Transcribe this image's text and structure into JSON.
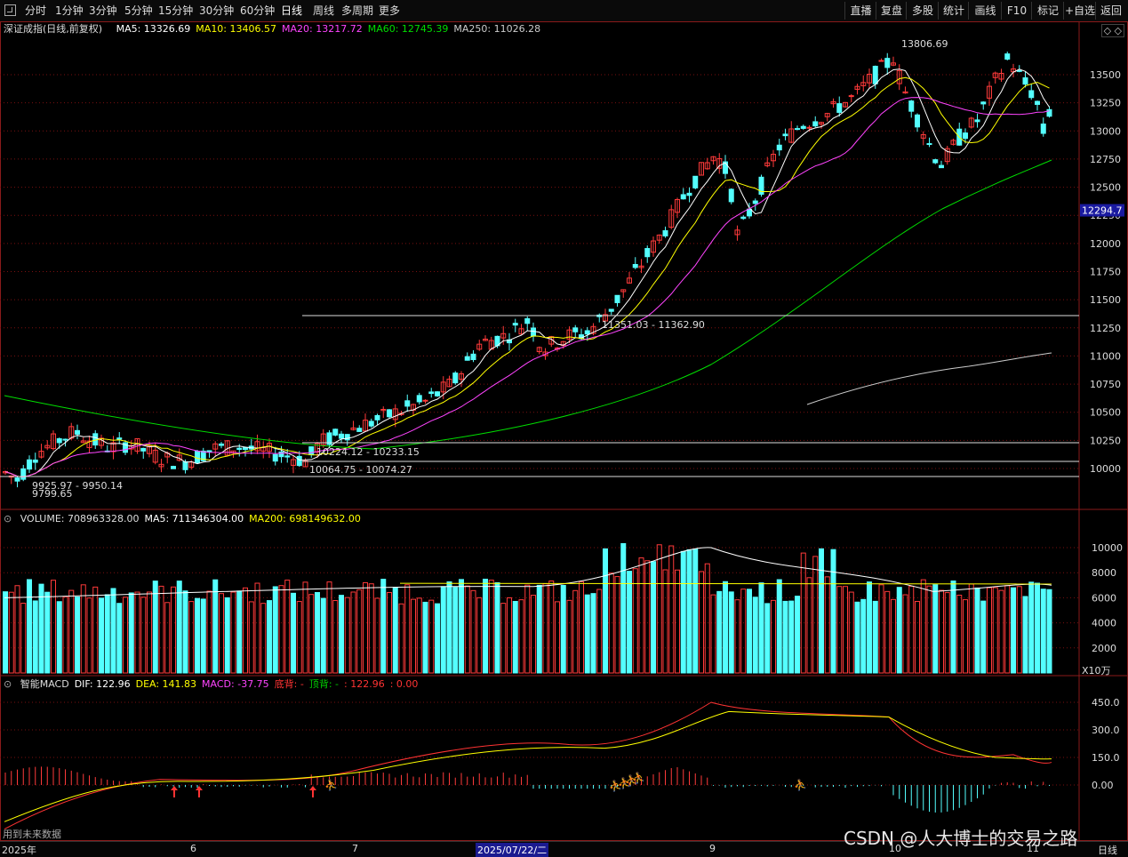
{
  "menu": {
    "left": [
      "分时",
      "1分钟",
      "3分钟",
      "5分钟",
      "15分钟",
      "30分钟",
      "60分钟",
      "日线",
      "周线",
      "多周期",
      "更多"
    ],
    "active": "日线",
    "right": [
      "直播",
      "复盘",
      "多股",
      "统计",
      "画线",
      "F10",
      "标记",
      "+自选",
      "返回"
    ]
  },
  "price_panel": {
    "name": "深证成指(日线,前复权)",
    "ma": [
      {
        "label": "MA5: 13326.69",
        "color": "#ffffff"
      },
      {
        "label": "MA10: 13406.57",
        "color": "#ffff00"
      },
      {
        "label": "MA20: 13217.72",
        "color": "#ff44ff"
      },
      {
        "label": "MA60: 12745.39",
        "color": "#00dd00"
      },
      {
        "label": "MA250: 11026.28",
        "color": "#cccccc"
      }
    ],
    "current_price": "12294.7",
    "y_ticks": [
      "13500",
      "13250",
      "13000",
      "12750",
      "12500",
      "12250",
      "12000",
      "11750",
      "11500",
      "11250",
      "11000",
      "10750",
      "10500",
      "10250",
      "10000"
    ],
    "annotations": {
      "high": "13806.69",
      "low": "9799.65",
      "range1": "9925.97 - 9950.14",
      "range2": "10224.12 - 10233.15",
      "range3": "10064.75 - 10074.27",
      "range4": "11351.03 - 11362.90"
    }
  },
  "volume_panel": {
    "info": [
      {
        "label": "VOLUME: 708963328.00",
        "color": "#dddddd"
      },
      {
        "label": "MA5: 711346304.00",
        "color": "#ffffff"
      },
      {
        "label": "MA200: 698149632.00",
        "color": "#ffff00"
      }
    ],
    "y_ticks": [
      "10000",
      "8000",
      "6000",
      "4000",
      "2000"
    ],
    "unit": "X10万"
  },
  "macd_panel": {
    "info": [
      {
        "label": "智能MACD",
        "color": "#dddddd"
      },
      {
        "label": "DIF: 122.96",
        "color": "#ffffff"
      },
      {
        "label": "DEA: 141.83",
        "color": "#ffff00"
      },
      {
        "label": "MACD: -37.75",
        "color": "#ff44ff"
      },
      {
        "label": "底背: -",
        "color": "#ff3333"
      },
      {
        "label": "顶背: -",
        "color": "#00cc00"
      },
      {
        "label": ": 122.96",
        "color": "#ff3333"
      },
      {
        "label": ": 0.00",
        "color": "#ff3333"
      }
    ],
    "y_ticks": [
      "450.0",
      "300.0",
      "150.0",
      "0.00"
    ],
    "footnote": "用到未来数据"
  },
  "time_axis": [
    {
      "label": "2025年"
    },
    {
      "label": "6"
    },
    {
      "label": "7"
    },
    {
      "label": "2025/07/22/二",
      "highlight": true
    },
    {
      "label": "9"
    },
    {
      "label": "10"
    },
    {
      "label": "11"
    }
  ],
  "watermark": "CSDN @人大博士的交易之路",
  "bottom_right_label": "日线",
  "colors": {
    "up": "#ff3a3a",
    "down": "#54ffff",
    "ma5": "#ffffff",
    "ma10": "#ffff00",
    "ma20": "#ff44ff",
    "ma60": "#00dd00",
    "ma250": "#cccccc",
    "grid": "#7a1010"
  }
}
